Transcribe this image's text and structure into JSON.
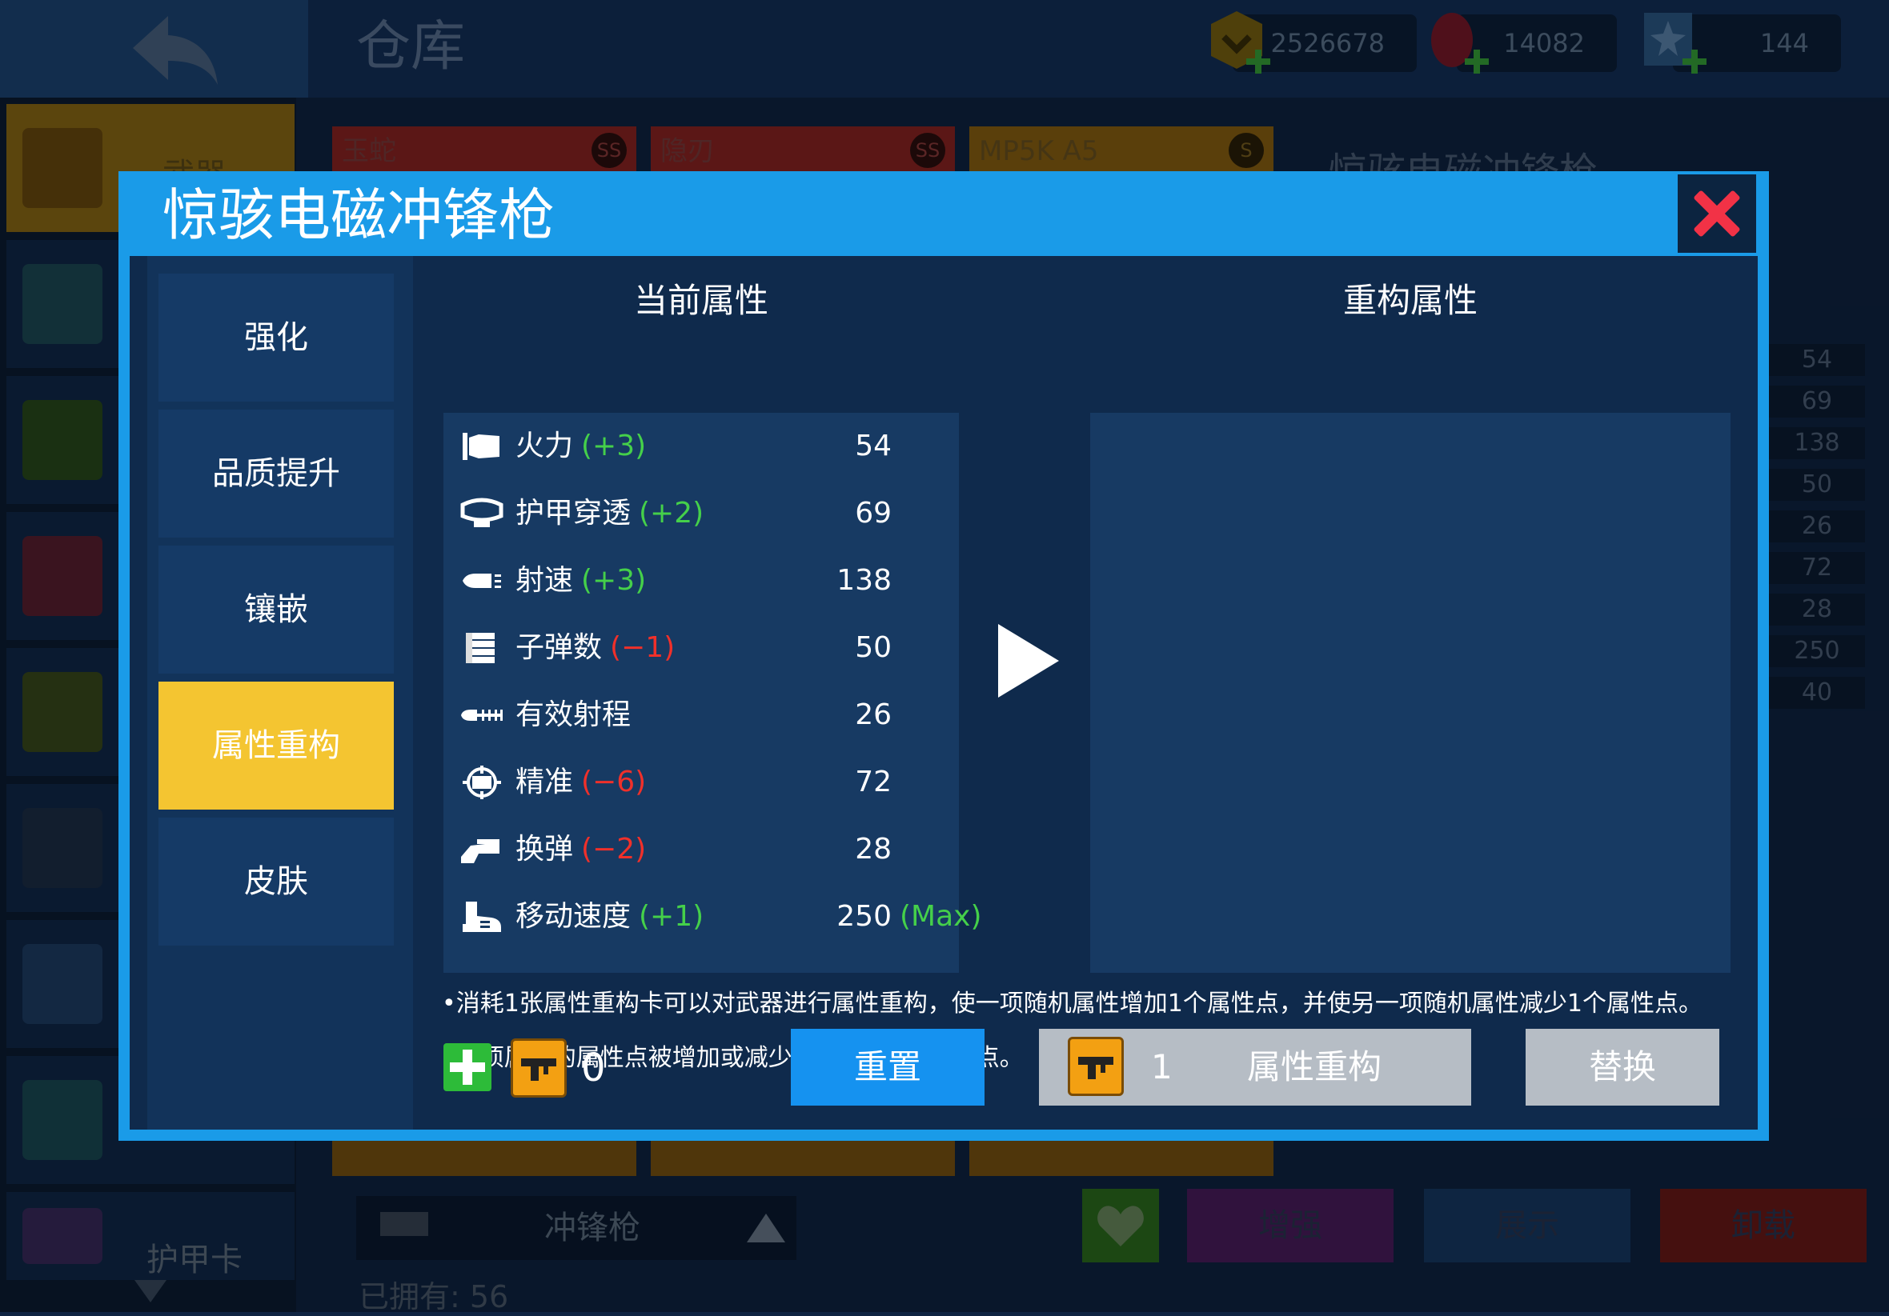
{
  "background": {
    "page_title": "仓库",
    "currencies": [
      {
        "icon": "gold-coin-icon",
        "value": "2526678"
      },
      {
        "icon": "gem-icon",
        "value": "14082"
      },
      {
        "icon": "point-ticket-icon",
        "value": "144"
      }
    ],
    "sidebar": {
      "weapon_label": "武器",
      "armor_card_label": "护甲卡"
    },
    "weapon_cards": [
      {
        "name": "玉蛇",
        "grade": "SS",
        "color": "#b7241f"
      },
      {
        "name": "隐刃",
        "grade": "SS",
        "color": "#b7241f"
      },
      {
        "name": "MP5K A5",
        "grade": "S",
        "color": "#cf8f12"
      }
    ],
    "right_panel_title": "惊骇电磁冲锋枪",
    "right_panel_stats": [
      "54",
      "69",
      "138",
      "50",
      "26",
      "72",
      "28",
      "250",
      "40"
    ],
    "category_dropdown": "冲锋枪",
    "buttons": {
      "enhance": "增强",
      "show": "展示",
      "unequip": "卸载"
    },
    "owned_text": "已拥有: 56"
  },
  "modal": {
    "title": "惊骇电磁冲锋枪",
    "tabs": [
      {
        "label": "强化",
        "active": false
      },
      {
        "label": "品质提升",
        "active": false
      },
      {
        "label": "镶嵌",
        "active": false
      },
      {
        "label": "属性重构",
        "active": true
      },
      {
        "label": "皮肤",
        "active": false
      }
    ],
    "current_title": "当前属性",
    "new_title": "重构属性",
    "stats": [
      {
        "icon": "firepower-icon",
        "name": "火力",
        "delta": "(+3)",
        "sign": "pos",
        "value": "54",
        "max": ""
      },
      {
        "icon": "armor-pierce-icon",
        "name": "护甲穿透",
        "delta": "(+2)",
        "sign": "pos",
        "value": "69",
        "max": ""
      },
      {
        "icon": "fire-rate-icon",
        "name": "射速",
        "delta": "(+3)",
        "sign": "pos",
        "value": "138",
        "max": ""
      },
      {
        "icon": "ammo-count-icon",
        "name": "子弹数",
        "delta": "(−1)",
        "sign": "neg",
        "value": "50",
        "max": ""
      },
      {
        "icon": "range-icon",
        "name": "有效射程",
        "delta": "",
        "sign": "",
        "value": "26",
        "max": ""
      },
      {
        "icon": "accuracy-icon",
        "name": "精准",
        "delta": "(−6)",
        "sign": "neg",
        "value": "72",
        "max": ""
      },
      {
        "icon": "reload-icon",
        "name": "换弹",
        "delta": "(−2)",
        "sign": "neg",
        "value": "28",
        "max": ""
      },
      {
        "icon": "move-speed-icon",
        "name": "移动速度",
        "delta": "(+1)",
        "sign": "pos",
        "value": "250",
        "max": "(Max)"
      }
    ],
    "notes": [
      "•消耗1张属性重构卡可以对武器进行属性重构，使一项随机属性增加1个属性点，并使另一项随机属性减少1个属性点。",
      "•每项属性的属性点被增加或减少的最高上限均为6点。"
    ],
    "owned_cards": "0",
    "cost_cards": "1",
    "reset_label": "重置",
    "reroll_label": "属性重构",
    "replace_label": "替换",
    "colors": {
      "accent": "#1a9be8",
      "active_tab": "#f4c531",
      "positive": "#45d04a",
      "negative": "#f0302a"
    }
  }
}
